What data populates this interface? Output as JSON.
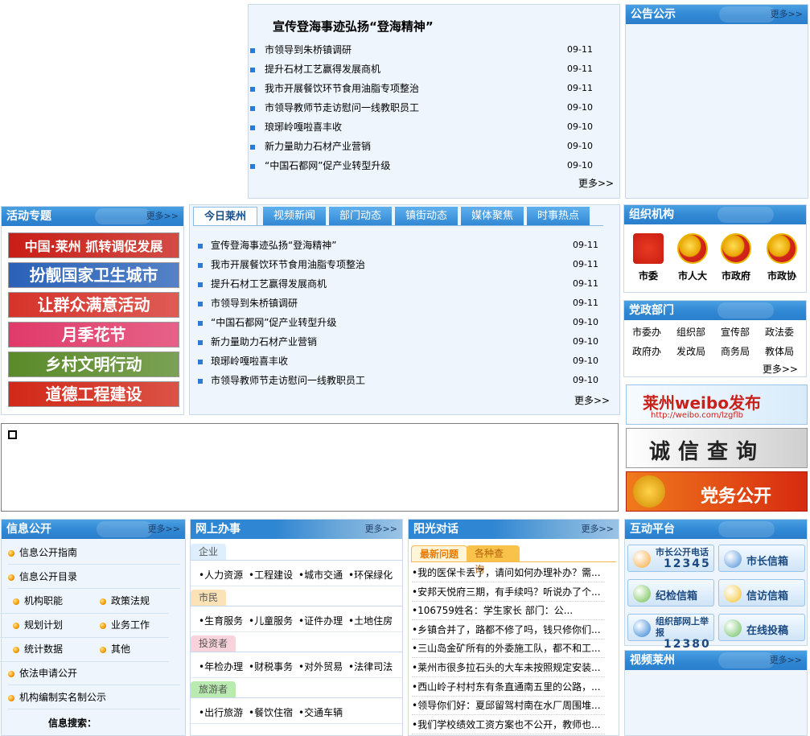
{
  "top_news": {
    "title": "宣传登海事迹弘扬“登海精神”",
    "items": [
      {
        "text": "市领导到朱桥镇调研",
        "date": "09-11"
      },
      {
        "text": "提升石材工艺赢得发展商机",
        "date": "09-11"
      },
      {
        "text": "我市开展餐饮环节食用油脂专项整治",
        "date": "09-11"
      },
      {
        "text": "市领导教师节走访慰问一线教职员工",
        "date": "09-10"
      },
      {
        "text": "琅琊岭嘎啦喜丰收",
        "date": "09-10"
      },
      {
        "text": "新力量助力石材产业营销",
        "date": "09-10"
      },
      {
        "text": "“中国石都网”促产业转型升级",
        "date": "09-10"
      }
    ],
    "more": "更多>>"
  },
  "notice": {
    "title": "公告公示",
    "more": "更多>>"
  },
  "activities": {
    "title": "活动专题",
    "more": "更多>>",
    "banners": [
      {
        "text": "中国·莱州 抓转调促发展",
        "color": "#c81e17"
      },
      {
        "text": "扮靓国家卫生城市",
        "color": "#2a62b8"
      },
      {
        "text": "让群众满意活动",
        "color": "#d6332a"
      },
      {
        "text": "月季花节",
        "color": "#e03a6a"
      },
      {
        "text": "乡村文明行动",
        "color": "#5a8a2a"
      },
      {
        "text": "道德工程建设",
        "color": "#d12818"
      }
    ]
  },
  "tabs": {
    "labels": [
      "今日莱州",
      "视频新闻",
      "部门动态",
      "镇街动态",
      "媒体聚焦",
      "时事热点"
    ],
    "items": [
      {
        "text": "宣传登海事迹弘扬“登海精神”",
        "date": "09-11"
      },
      {
        "text": "我市开展餐饮环节食用油脂专项整治",
        "date": "09-11"
      },
      {
        "text": "提升石材工艺赢得发展商机",
        "date": "09-11"
      },
      {
        "text": "市领导到朱桥镇调研",
        "date": "09-11"
      },
      {
        "text": "“中国石都网”促产业转型升级",
        "date": "09-10"
      },
      {
        "text": "新力量助力石材产业营销",
        "date": "09-10"
      },
      {
        "text": "琅琊岭嘎啦喜丰收",
        "date": "09-10"
      },
      {
        "text": "市领导教师节走访慰问一线教职员工",
        "date": "09-10"
      }
    ],
    "more": "更多>>"
  },
  "org": {
    "title": "组织机构",
    "items": [
      "市委",
      "市人大",
      "市政府",
      "市政协"
    ]
  },
  "depts": {
    "title": "党政部门",
    "row1": [
      "市委办",
      "组织部",
      "宣传部",
      "政法委"
    ],
    "row2": [
      "政府办",
      "发改局",
      "商务局",
      "教体局"
    ],
    "more": "更多>>"
  },
  "side_banners": [
    {
      "text": "莱州weibo发布",
      "sub": "http://weibo.com/lzgflb",
      "color": "#c8201a"
    },
    {
      "text": "诚信查询",
      "color": "#333333"
    },
    {
      "text": "党务公开",
      "color": "#d4280f"
    }
  ],
  "info_open": {
    "title": "信息公开",
    "more": "更多>>",
    "guide": "信息公开指南",
    "catalog": "信息公开目录",
    "grid": [
      "机构职能",
      "政策法规",
      "规划计划",
      "业务工作",
      "统计数据",
      "其他"
    ],
    "apply": "依法申请公开",
    "staff": "机构编制实名制公示",
    "search": "信息搜索："
  },
  "online": {
    "title": "网上办事",
    "more": "更多>>",
    "groups": [
      {
        "label": "企业",
        "items": [
          "人力资源",
          "工程建设",
          "城市交通",
          "环保绿化"
        ],
        "color": "#dfeefc"
      },
      {
        "label": "市民",
        "items": [
          "生育服务",
          "儿童服务",
          "证件办理",
          "土地住房"
        ],
        "color": "#fbe3b7"
      },
      {
        "label": "投资者",
        "items": [
          "年检办理",
          "财税事务",
          "对外贸易",
          "法律司法"
        ],
        "color": "#f9d3dc"
      },
      {
        "label": "旅游者",
        "items": [
          "出行旅游",
          "餐饮住宿",
          "交通车辆"
        ],
        "color": "#b9eab0"
      }
    ]
  },
  "sunshine": {
    "title": "阳光对话",
    "more": "更多>>",
    "tabs": [
      "最新问题",
      "各种查询"
    ],
    "items": [
      "•我的医保卡丢了，请问如何办理补办？需...",
      "•安邦天悦府三期，有手续吗？听说办了个...",
      "•106759姓名：学生家长  部门：公...",
      "•乡镇合并了，路都不修了吗，钱只修你们...",
      "•三山岛金矿所有的外委施工队，都不和工...",
      "•莱州市很多拉石头的大车未按照规定安装...",
      "•西山岭子村村东有条直通南五里的公路，...",
      "•领导你们好：夏邱留驾村南在水厂周围堆...",
      "•我们学校绩效工资方案也不公开，教师也..."
    ]
  },
  "interactive": {
    "title": "互动平台",
    "buttons": [
      {
        "label": "市长公开电话",
        "sub": "12345"
      },
      {
        "label": "市长信箱"
      },
      {
        "label": "纪检信箱"
      },
      {
        "label": "信访信箱"
      },
      {
        "label": "组织部网上举报",
        "sub": "12380"
      },
      {
        "label": "在线投稿"
      }
    ]
  },
  "video": {
    "title": "视频莱州",
    "more": "更多>>"
  },
  "colors": {
    "header_blue": "#2f86d2",
    "panel_bg": "#eef5fc",
    "border": "#c9d9ea",
    "accent_orange": "#f39a00"
  }
}
